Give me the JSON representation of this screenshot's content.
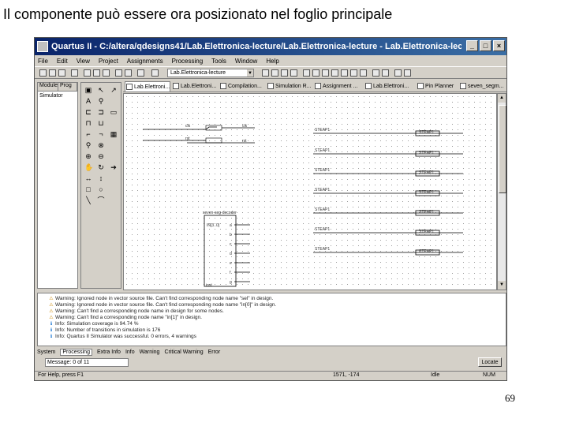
{
  "slide": {
    "title": "Il componente può essere ora posizionato nel foglio principale",
    "page_number": "69"
  },
  "window": {
    "title": "Quartus II - C:/altera/qdesigns41/Lab.Elettronica-lecture/Lab.Elettronica-lecture - Lab.Elettronica-lec...",
    "menu": [
      "File",
      "Edit",
      "View",
      "Project",
      "Assignments",
      "Processing",
      "Tools",
      "Window",
      "Help"
    ],
    "toolbar": {
      "project_combo": "Lab.Elettronica-lecture"
    },
    "left_panel": {
      "columns": [
        "Module",
        "Prog"
      ],
      "rows": [
        {
          "module": "Simulator",
          "progress": ""
        }
      ]
    },
    "tabs": [
      "Lab.Elettroni...",
      "Lab.Elettroni...",
      "Compilation...",
      "Simulation R...",
      "Assignment ...",
      "Lab.Elettroni...",
      "Pin Planner",
      "seven_segm..."
    ],
    "schematic": {
      "inputs": [
        "clk",
        "rst"
      ],
      "pins_in": [
        "clk",
        "rst"
      ],
      "bus_label": "IN[...]",
      "component_name": "seven-seg-decoder",
      "component_bus": "IN[3..0]",
      "component_outputs": [
        "a",
        "b",
        "c",
        "d",
        "e",
        "f",
        "g"
      ],
      "component_inst": "inst",
      "outputs": [
        {
          "bus": "STEAP1",
          "pin": "STEAP1"
        },
        {
          "bus": "STEAP1",
          "pin": "STEAP1"
        },
        {
          "bus": "STEAP1",
          "pin": "STEAP1"
        },
        {
          "bus": "STEAP1",
          "pin": "STEAP1"
        },
        {
          "bus": "STEAP1",
          "pin": "STEAP1"
        },
        {
          "bus": "STEAP1",
          "pin": "STEAP1"
        },
        {
          "bus": "STEAP1",
          "pin": "STEAP1"
        }
      ]
    },
    "messages": [
      {
        "type": "warning",
        "text": "Warning: Ignored node in vector source file. Can't find corresponding node name \"sel\" in design."
      },
      {
        "type": "warning",
        "text": "Warning: Ignored node in vector source file. Can't find corresponding node name \"in[0]\" in design."
      },
      {
        "type": "warning",
        "text": "Warning: Can't find a corresponding node name in design for some nodes."
      },
      {
        "type": "warning",
        "text": "Warning: Can't find a corresponding node name \"in[1]\" in design."
      },
      {
        "type": "info",
        "text": "Info: Simulation coverage is  94.74 %"
      },
      {
        "type": "info",
        "text": "Info: Number of transitions in simulation is 176"
      },
      {
        "type": "info",
        "text": "Info: Quartus II Simulator was successful. 0 errors, 4 warnings"
      }
    ],
    "bottom_tabs": [
      "System",
      "Processing",
      "Extra Info",
      "Info",
      "Warning",
      "Critical Warning",
      "Error"
    ],
    "message_field": "Message: 0 of 11",
    "location_button": "Locate",
    "status_bar": {
      "help": "For Help, press F1",
      "coords": "1571, -174",
      "state": "Idle",
      "mode": "NUM"
    }
  }
}
